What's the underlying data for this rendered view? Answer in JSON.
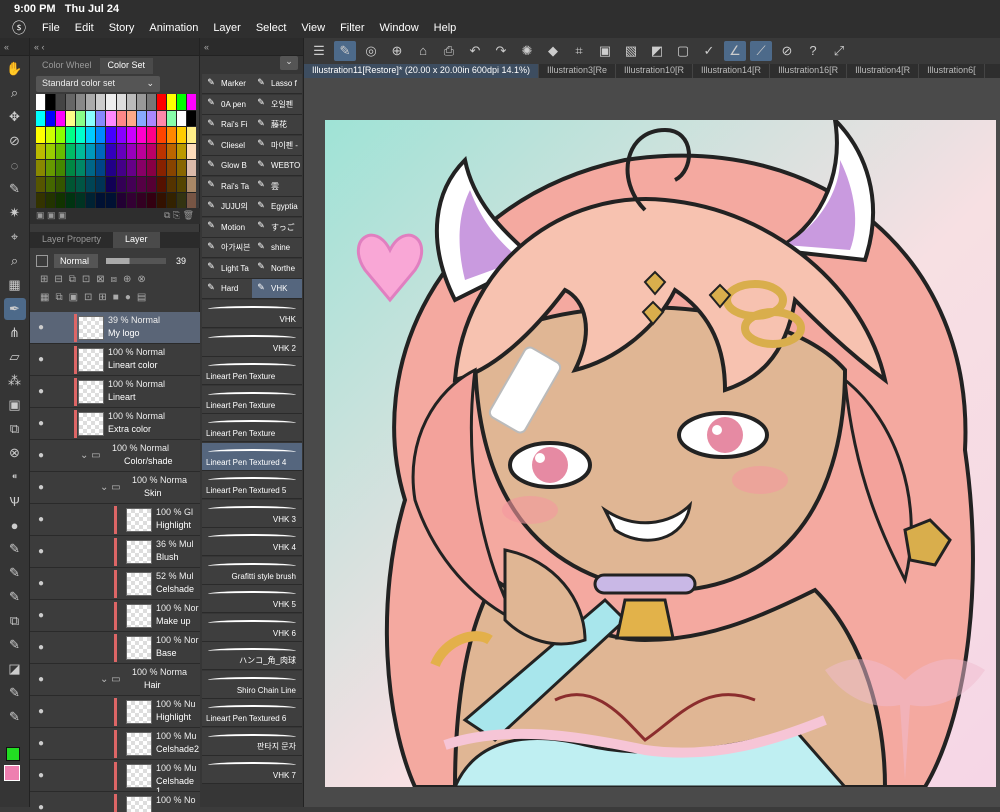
{
  "system": {
    "time": "9:00 PM",
    "date": "Thu Jul 24"
  },
  "menu": [
    "File",
    "Edit",
    "Story",
    "Animation",
    "Layer",
    "Select",
    "View",
    "Filter",
    "Window",
    "Help"
  ],
  "color_panel": {
    "tabs": [
      "Color Wheel",
      "Color Set"
    ],
    "set_name": "Standard color set"
  },
  "layer_panel": {
    "tabs": [
      "Layer Property",
      "Layer"
    ],
    "blend_mode": "Normal",
    "opacity": "39",
    "layers": [
      {
        "pct": "39 %",
        "mode": "Normal",
        "name": "My logo",
        "selected": true
      },
      {
        "pct": "100 %",
        "mode": "Normal",
        "name": "Lineart color"
      },
      {
        "pct": "100 %",
        "mode": "Normal",
        "name": "Lineart"
      },
      {
        "pct": "100 %",
        "mode": "Normal",
        "name": "Extra color"
      },
      {
        "pct": "100 %",
        "mode": "Normal",
        "name": "Color/shade"
      },
      {
        "pct": "100 %",
        "mode": "Norma",
        "name": "Skin"
      },
      {
        "pct": "100 %",
        "mode": "Gl",
        "name": "Highlight"
      },
      {
        "pct": "36 %",
        "mode": "Mul",
        "name": "Blush"
      },
      {
        "pct": "52 %",
        "mode": "Mul",
        "name": "Celshade"
      },
      {
        "pct": "100 %",
        "mode": "Nor",
        "name": "Make up"
      },
      {
        "pct": "100 %",
        "mode": "Nor",
        "name": "Base"
      },
      {
        "pct": "100 %",
        "mode": "Norma",
        "name": "Hair"
      },
      {
        "pct": "100 %",
        "mode": "Nu",
        "name": "Highlight"
      },
      {
        "pct": "100 %",
        "mode": "Mu",
        "name": "Celshade2"
      },
      {
        "pct": "100 %",
        "mode": "Mu",
        "name": "Celshade 1"
      },
      {
        "pct": "100 %",
        "mode": "No",
        "name": ""
      }
    ]
  },
  "brush_groups": [
    [
      "Marker",
      "Lasso f"
    ],
    [
      "0A pen",
      "오일펜"
    ],
    [
      "Rai's Fi",
      "藤花"
    ],
    [
      "Cliesel",
      "마이펜 -"
    ],
    [
      "Glow B",
      "WEBTO"
    ],
    [
      "Rai's Ta",
      "雲"
    ],
    [
      "JUJU의",
      "Egyptia"
    ],
    [
      "Motion",
      "すっご"
    ],
    [
      "아가씨븐",
      "shine"
    ],
    [
      "Light Ta",
      "Northe"
    ],
    [
      "Hard",
      "VHK"
    ]
  ],
  "brushes": [
    {
      "name": "VHK",
      "align": "r"
    },
    {
      "name": "VHK 2",
      "align": "r"
    },
    {
      "name": "Lineart Pen Texture",
      "align": "l"
    },
    {
      "name": "Lineart Pen Texture",
      "align": "l"
    },
    {
      "name": "Lineart Pen Texture",
      "align": "l"
    },
    {
      "name": "Lineart Pen Textured 4",
      "align": "l",
      "selected": true
    },
    {
      "name": "Lineart Pen Textured 5",
      "align": "l"
    },
    {
      "name": "VHK 3",
      "align": "r"
    },
    {
      "name": "VHK 4",
      "align": "r"
    },
    {
      "name": "Grafitti style brush",
      "align": "r"
    },
    {
      "name": "VHK 5",
      "align": "r"
    },
    {
      "name": "VHK 6",
      "align": "r"
    },
    {
      "name": "ハンコ_角_肉球",
      "align": "r"
    },
    {
      "name": "Shiro Chain Line",
      "align": "r"
    },
    {
      "name": "Lineart Pen Textured 6",
      "align": "l"
    },
    {
      "name": "판타지 문자",
      "align": "r"
    },
    {
      "name": "VHK 7",
      "align": "r"
    }
  ],
  "doc_tabs": [
    {
      "label": "Illustration11[Restore]* (20.00 x 20.00in 600dpi 14.1%)",
      "active": true
    },
    {
      "label": "Illustration3[Re"
    },
    {
      "label": "Illustration10[R"
    },
    {
      "label": "Illustration14[R"
    },
    {
      "label": "Illustration16[R"
    },
    {
      "label": "Illustration4[R"
    },
    {
      "label": "Illustration6["
    }
  ],
  "colors": {
    "main": "#ee7fb0",
    "sub": "#ffffff"
  }
}
